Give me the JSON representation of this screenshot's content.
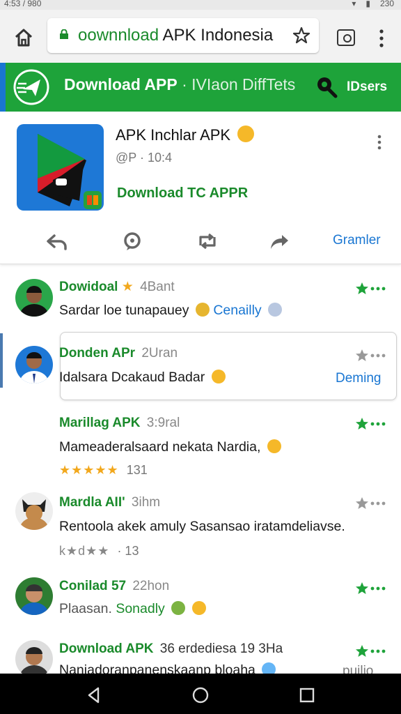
{
  "status": {
    "left_text": "4:53 / 980",
    "right_text": "230"
  },
  "browser": {
    "url_prefix": "oownnload",
    "url_main": "APK Indonesia",
    "icons": [
      "home-icon",
      "lock-icon",
      "bookmark-star-icon",
      "tabs-icon",
      "menu-dots-icon"
    ]
  },
  "header": {
    "title_bold": "Download APP",
    "title_rest": "· IVIaon DiffTets",
    "button": "IDsers"
  },
  "post": {
    "title": "APK Inchlar APK",
    "meta": "@P · 10:4",
    "download": "Download TC APPR",
    "actions": [
      "reply-icon",
      "comment-icon",
      "retweet-icon",
      "share-icon"
    ],
    "action_label": "Gramler"
  },
  "comments": [
    {
      "name": "Dowidoal",
      "time": "4Bant",
      "text": "Sardar loe tunapauey",
      "link": "Cenailly",
      "star_active": true
    },
    {
      "name": "Donden APr",
      "time": "2Uran",
      "text": "Idalsara Dcakaud Badar",
      "right_label": "Deming",
      "star_active": false
    },
    {
      "name": "Marillag APK",
      "time": "3:9ral",
      "text": "Mameaderalsaard nekata Nardia,",
      "stars": "★★★★★",
      "count": "131",
      "star_active": true
    },
    {
      "name": "Mardla AII'",
      "time": "3ihm",
      "text": "Rentoola akek amuly Sasansao iratamdeliavse.",
      "stars": "k★d★★",
      "count": "· 13",
      "star_active": false
    },
    {
      "name": "Conilad 57",
      "time": "22hon",
      "text": "Plaasan.",
      "link": "Sonadly",
      "star_active": true
    },
    {
      "name": "Download APK",
      "time": "36 erdediesa 19 3Ha",
      "text": "Naniadoranpanenskaanp bloaha",
      "right_label": "puilio",
      "star_active": true
    }
  ],
  "colors": {
    "green": "#1ea33a",
    "link_blue": "#1976d2",
    "star": "#f2a81d"
  }
}
